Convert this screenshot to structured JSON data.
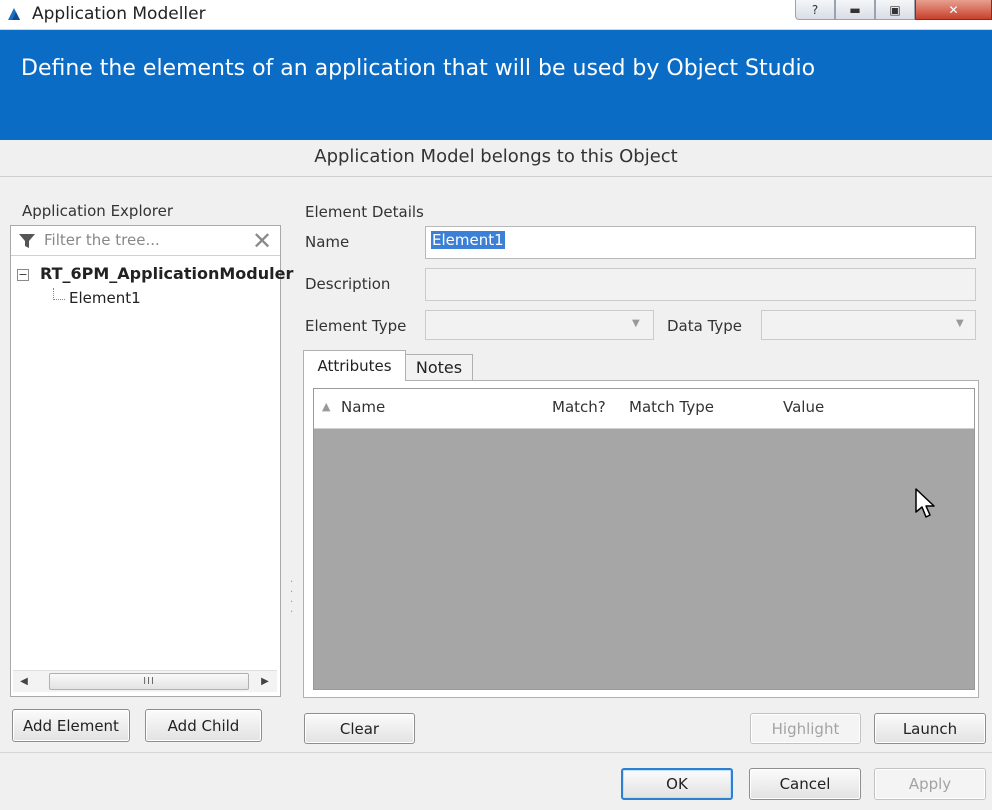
{
  "window": {
    "title": "Application Modeller",
    "controls": {
      "help": "?",
      "minimize": "▬",
      "maximize": "▣",
      "close": "✕"
    }
  },
  "header": {
    "description": "Define the elements of an application that will be used by Object Studio",
    "background_color": "#0b6cc6"
  },
  "object_label": "Application Model belongs to this Object",
  "explorer": {
    "title": "Application Explorer",
    "filter_placeholder": "Filter the tree...",
    "clear_icon": "close-icon",
    "tree": {
      "root_label": "RT_6PM_ApplicationModuler",
      "children": [
        "Element1"
      ]
    },
    "scroll_thumb_grip": "III"
  },
  "explorer_buttons": {
    "add_element": "Add Element",
    "add_child": "Add Child"
  },
  "details": {
    "title": "Element Details",
    "name_label": "Name",
    "name_value": "Element1",
    "description_label": "Description",
    "description_value": "",
    "element_type_label": "Element Type",
    "element_type_value": "",
    "data_type_label": "Data Type",
    "data_type_value": ""
  },
  "tabs": [
    {
      "label": "Attributes",
      "active": true
    },
    {
      "label": "Notes",
      "active": false
    }
  ],
  "attributes_grid": {
    "columns": [
      "Name",
      "Match?",
      "Match Type",
      "Value"
    ],
    "rows": [],
    "empty_color": "#a6a6a6"
  },
  "detail_buttons": {
    "clear": "Clear",
    "highlight": "Highlight",
    "launch": "Launch"
  },
  "dialog_buttons": {
    "ok": "OK",
    "cancel": "Cancel",
    "apply": "Apply"
  }
}
